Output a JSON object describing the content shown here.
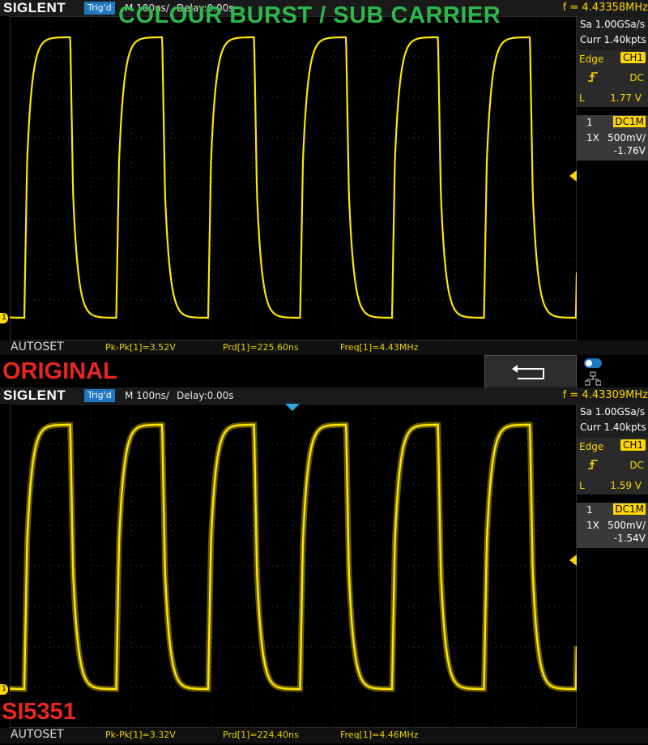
{
  "banner_top": "COLOUR BURST / SUB CARRIER",
  "label_original": "ORIGINAL",
  "label_si": "SI5351",
  "scopes": [
    {
      "logo": "SIGLENT",
      "trig": "Trig'd",
      "timebase": "M 100ns/",
      "delay": "Delay:0.00s",
      "freq": "f = 4.43358MHz",
      "sample_rate": "Sa 1.00GSa/s",
      "curr": "Curr 1.40kpts",
      "trigger_type": "Edge",
      "trigger_source": "CH1",
      "coupling": "DC",
      "level_label": "L",
      "level": "1.77 V",
      "channel_num": "1",
      "channel_coupling": "DC1M",
      "probe": "1X",
      "vdiv": "500mV/",
      "offset": "-1.76V",
      "autoset": "AUTOSET",
      "meas_pkpk": "Pk-Pk[1]=3.52V",
      "meas_prd": "Prd[1]=225.60ns",
      "meas_freq": "Freq[1]=4.43MHz",
      "marker": "1"
    },
    {
      "logo": "SIGLENT",
      "trig": "Trig'd",
      "timebase": "M 100ns/",
      "delay": "Delay:0.00s",
      "freq": "f = 4.43309MHz",
      "sample_rate": "Sa 1.00GSa/s",
      "curr": "Curr 1.40kpts",
      "trigger_type": "Edge",
      "trigger_source": "CH1",
      "coupling": "DC",
      "level_label": "L",
      "level": "1.59 V",
      "channel_num": "1",
      "channel_coupling": "DC1M",
      "probe": "1X",
      "vdiv": "500mV/",
      "offset": "-1.54V",
      "autoset": "AUTOSET",
      "meas_pkpk": "Pk-Pk[1]=3.32V",
      "meas_prd": "Prd[1]=224.40ns",
      "meas_freq": "Freq[1]=4.46MHz",
      "marker": "1"
    }
  ],
  "colors": {
    "trace": "#ffe600",
    "banner_green": "#2db84a",
    "banner_red": "#e8281e",
    "trig_blue": "#1f78c1"
  },
  "icons": [
    "back-arrow-icon",
    "network-icon",
    "toggle-icon",
    "rising-edge-icon"
  ]
}
